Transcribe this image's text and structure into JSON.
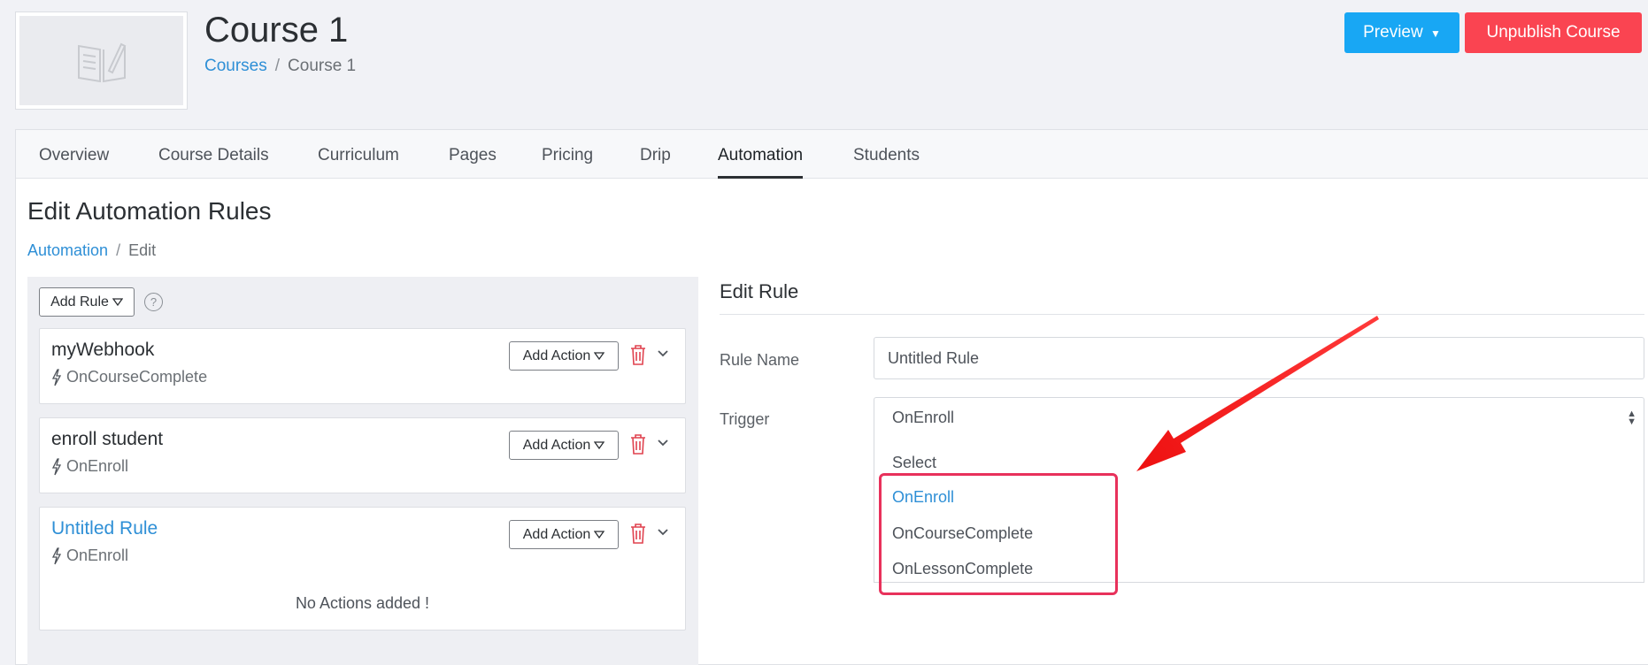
{
  "header": {
    "course_title": "Course 1",
    "breadcrumb": {
      "root": "Courses",
      "separator": "/",
      "current": "Course 1"
    },
    "preview_label": "Preview",
    "unpublish_label": "Unpublish Course"
  },
  "tabs": [
    {
      "label": "Overview"
    },
    {
      "label": "Course Details"
    },
    {
      "label": "Curriculum"
    },
    {
      "label": "Pages"
    },
    {
      "label": "Pricing"
    },
    {
      "label": "Drip"
    },
    {
      "label": "Automation",
      "active": true
    },
    {
      "label": "Students"
    }
  ],
  "page": {
    "heading": "Edit Automation Rules",
    "breadcrumb": {
      "root": "Automation",
      "separator": "/",
      "current": "Edit"
    }
  },
  "rules_panel": {
    "add_rule_label": "Add Rule",
    "help_symbol": "?",
    "add_action_label": "Add Action",
    "rules": [
      {
        "name": "myWebhook",
        "trigger": "OnCourseComplete"
      },
      {
        "name": "enroll student",
        "trigger": "OnEnroll"
      },
      {
        "name": "Untitled Rule",
        "trigger": "OnEnroll",
        "empty_message": "No Actions added !"
      }
    ]
  },
  "edit_rule": {
    "title": "Edit Rule",
    "rule_name_label": "Rule Name",
    "rule_name_value": "Untitled Rule",
    "trigger_label": "Trigger",
    "trigger_value": "OnEnroll",
    "trigger_options": [
      "Select",
      "OnEnroll",
      "OnCourseComplete",
      "OnLessonComplete"
    ],
    "selected_option": "OnEnroll"
  },
  "colors": {
    "preview_button": "#18a7f4",
    "unpublish_button": "#fa4451",
    "link": "#2e8fd6",
    "annotation": "#e8315b",
    "arrow": "#f01a1a"
  },
  "icons": {
    "thumbnail": "book-edit-icon",
    "trigger": "lightning-icon",
    "delete": "trash-icon",
    "expand": "chevron-down-icon",
    "dropdown": "caret-down-icon"
  }
}
